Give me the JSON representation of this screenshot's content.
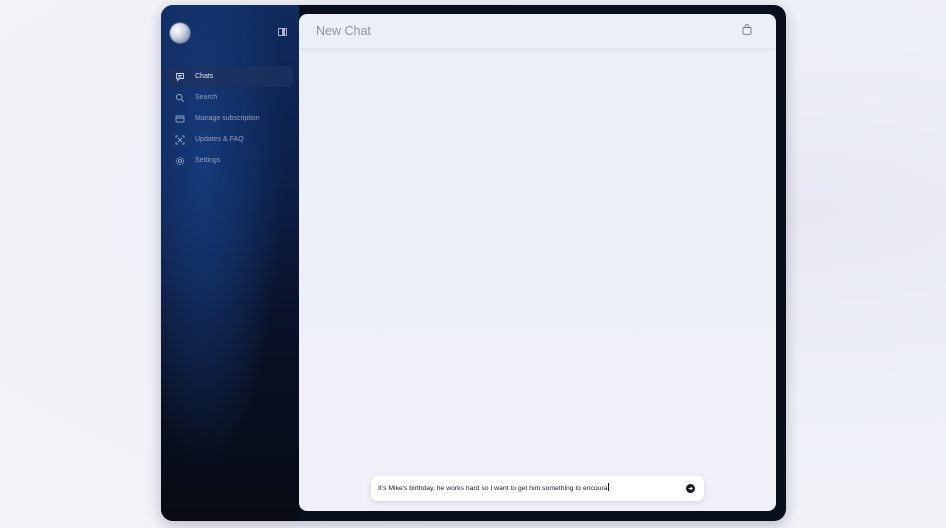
{
  "sidebar": {
    "items": [
      {
        "label": "Chats",
        "icon": "chat-icon",
        "active": true
      },
      {
        "label": "Search",
        "icon": "search-icon",
        "active": false
      },
      {
        "label": "Manage subscription",
        "icon": "card-icon",
        "active": false
      },
      {
        "label": "Updates & FAQ",
        "icon": "expand-icon",
        "active": false
      },
      {
        "label": "Settings",
        "icon": "gear-icon",
        "active": false
      }
    ]
  },
  "main": {
    "title": "New Chat"
  },
  "composer": {
    "value": "It's Mike's birthday, he works hard so I want to get him something to encoura"
  },
  "colors": {
    "sidebar_top": "#0f2a5c",
    "sidebar_bottom": "#080b14",
    "main_bg": "#eef0f8",
    "send_button": "#15171d"
  }
}
